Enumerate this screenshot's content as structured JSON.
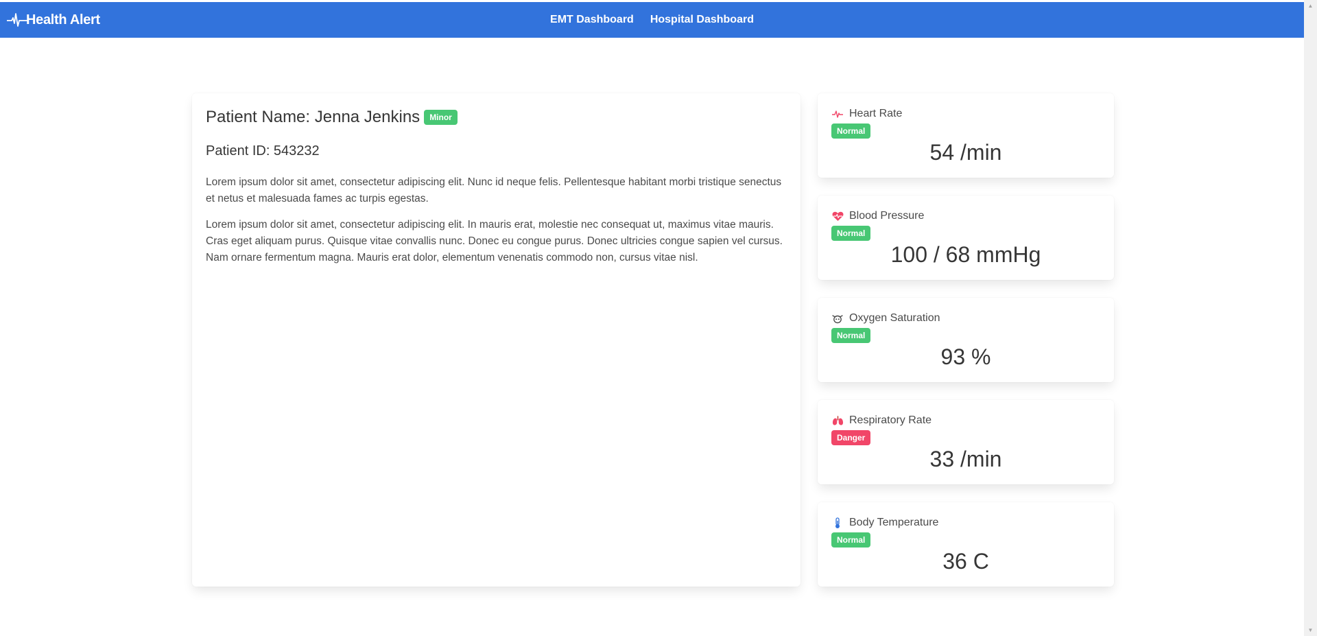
{
  "nav": {
    "brand": "Health Alert",
    "links": [
      "EMT Dashboard",
      "Hospital Dashboard"
    ]
  },
  "patient": {
    "name_label": "Patient Name: Jenna Jenkins",
    "severity": "Minor",
    "id_label": "Patient ID: 543232",
    "paragraphs": [
      "Lorem ipsum dolor sit amet, consectetur adipiscing elit. Nunc id neque felis. Pellentesque habitant morbi tristique senectus et netus et malesuada fames ac turpis egestas.",
      "Lorem ipsum dolor sit amet, consectetur adipiscing elit. In mauris erat, molestie nec consequat ut, maximus vitae mauris. Cras eget aliquam purus. Quisque vitae convallis nunc. Donec eu congue purus. Donec ultricies congue sapien vel cursus. Nam ornare fermentum magna. Mauris erat dolor, elementum venenatis commodo non, cursus vitae nisl."
    ]
  },
  "vitals": [
    {
      "label": "Heart Rate",
      "status": "Normal",
      "value": "54 /min",
      "icon": "heart-rate-icon"
    },
    {
      "label": "Blood Pressure",
      "status": "Normal",
      "value": "100 / 68 mmHg",
      "icon": "heart-pulse-icon"
    },
    {
      "label": "Oxygen Saturation",
      "status": "Normal",
      "value": "93 %",
      "icon": "oxygen-mask-icon"
    },
    {
      "label": "Respiratory Rate",
      "status": "Danger",
      "value": "33 /min",
      "icon": "lungs-icon"
    },
    {
      "label": "Body Temperature",
      "status": "Normal",
      "value": "36 C",
      "icon": "thermometer-icon"
    }
  ],
  "colors": {
    "navbar": "#3273dc",
    "success": "#48c774",
    "danger": "#f14668"
  }
}
